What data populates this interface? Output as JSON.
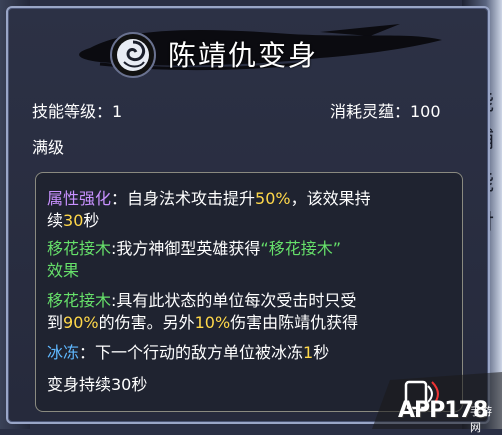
{
  "title": "陈靖仇变身",
  "skill_level_label": "技能等级：1",
  "cost_label": "消耗灵蕴：100",
  "max_level": "满级",
  "effects": [
    {
      "name": "属性强化",
      "parts": [
        "：自身法术攻击提升",
        "50%",
        "，该效果持"
      ],
      "line2": [
        "续",
        "30",
        "秒"
      ]
    },
    {
      "name": "移花接木",
      "parts": [
        ":我方神御型英雄获得",
        "“移花接木”"
      ],
      "line2": [
        "效果"
      ]
    },
    {
      "name": "移花接木",
      "parts": [
        ":具有此状态的单位每次受击时只受"
      ],
      "line2": [
        "到",
        "90%",
        "的伤害。另外",
        "10%",
        "伤害由陈靖仇获得"
      ]
    },
    {
      "name": "冰冻",
      "parts": [
        "：下一个行动的敌方单位被冰冻",
        "1",
        "秒"
      ]
    }
  ],
  "duration": "变身持续30秒",
  "colors": {
    "purple": "#c891ff",
    "green": "#66e06a",
    "blue": "#5fb8ff",
    "yellow": "#ffd84a"
  },
  "watermark": {
    "main": "APP178",
    "sub": "手游网"
  },
  "side_text": [
    "能",
    "辅",
    "能",
    "对"
  ]
}
